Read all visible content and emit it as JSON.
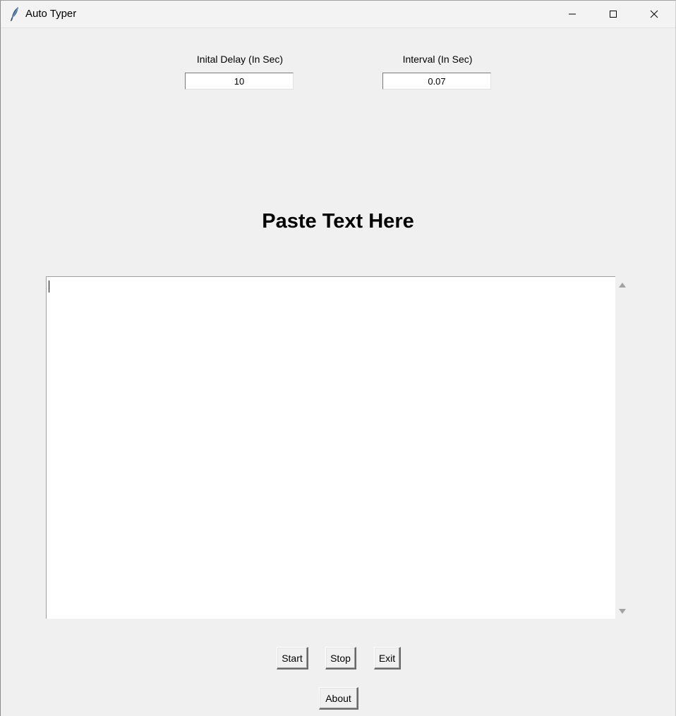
{
  "window": {
    "title": "Auto Typer"
  },
  "title_bar_controls": {
    "minimize_icon": "minimize-icon",
    "maximize_icon": "maximize-icon",
    "close_icon": "close-icon"
  },
  "settings": {
    "delay_label": "Inital Delay (In Sec)",
    "delay_value": "10",
    "interval_label": "Interval (In Sec)",
    "interval_value": "0.07"
  },
  "main": {
    "heading": "Paste Text Here",
    "text_value": ""
  },
  "buttons": {
    "start_label": "Start",
    "stop_label": "Stop",
    "exit_label": "Exit",
    "about_label": "About"
  }
}
